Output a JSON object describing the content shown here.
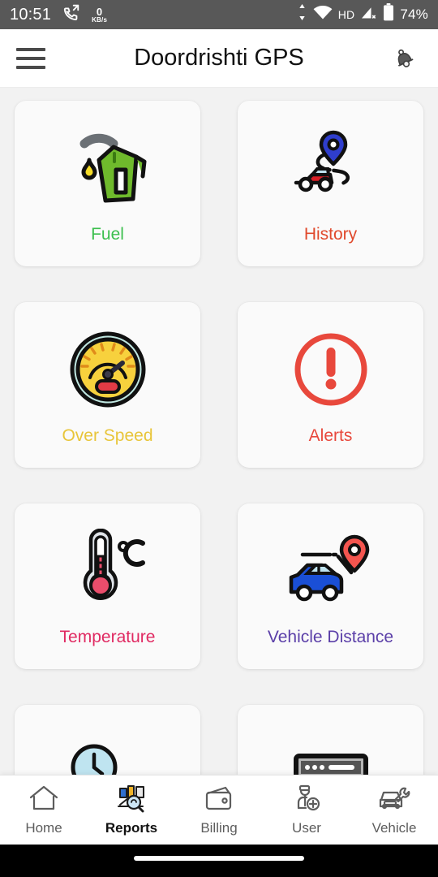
{
  "status_bar": {
    "time": "10:51",
    "call_icon": "call-forward-icon",
    "network_speed_value": "0",
    "network_speed_unit": "KB/s",
    "data_transfer_icon": "data-transfer-arrows-icon",
    "wifi_icon": "wifi-icon",
    "hd_label": "HD",
    "signal_icon": "cellular-signal-off-icon",
    "battery_icon": "battery-icon",
    "battery_percent": "74%",
    "background_color": "#585858",
    "text_color": "#ffffff"
  },
  "app_bar": {
    "menu_icon": "hamburger-menu-icon",
    "title": "Doordrishti GPS",
    "notification_icon": "bell-icon",
    "background_color": "#ffffff",
    "title_color": "#111111"
  },
  "grid": {
    "items": [
      {
        "label": "Fuel",
        "icon": "fuel-pump-icon",
        "color": "#3cbf4e"
      },
      {
        "label": "History",
        "icon": "route-history-icon",
        "color": "#e0492c"
      },
      {
        "label": "Over Speed",
        "icon": "speedometer-icon",
        "color": "#e8c53a"
      },
      {
        "label": "Alerts",
        "icon": "alert-exclamation-icon",
        "color": "#e8483c"
      },
      {
        "label": "Temperature",
        "icon": "thermometer-icon",
        "color": "#e02a62"
      },
      {
        "label": "Vehicle Distance",
        "icon": "car-distance-pin-icon",
        "color": "#5b3fa8"
      },
      {
        "label": "",
        "icon": "clock-car-icon",
        "color": "#333333"
      },
      {
        "label": "",
        "icon": "terminal-console-icon",
        "color": "#333333"
      }
    ],
    "card_background": "#fafafa",
    "page_background": "#f2f2f2"
  },
  "bottom_nav": {
    "items": [
      {
        "label": "Home",
        "icon": "home-icon",
        "active": false
      },
      {
        "label": "Reports",
        "icon": "reports-icon",
        "active": true
      },
      {
        "label": "Billing",
        "icon": "wallet-icon",
        "active": false
      },
      {
        "label": "User",
        "icon": "add-user-icon",
        "active": false
      },
      {
        "label": "Vehicle",
        "icon": "car-wrench-icon",
        "active": false
      }
    ],
    "active_color": "#111111",
    "inactive_color": "#5d5d5d"
  }
}
